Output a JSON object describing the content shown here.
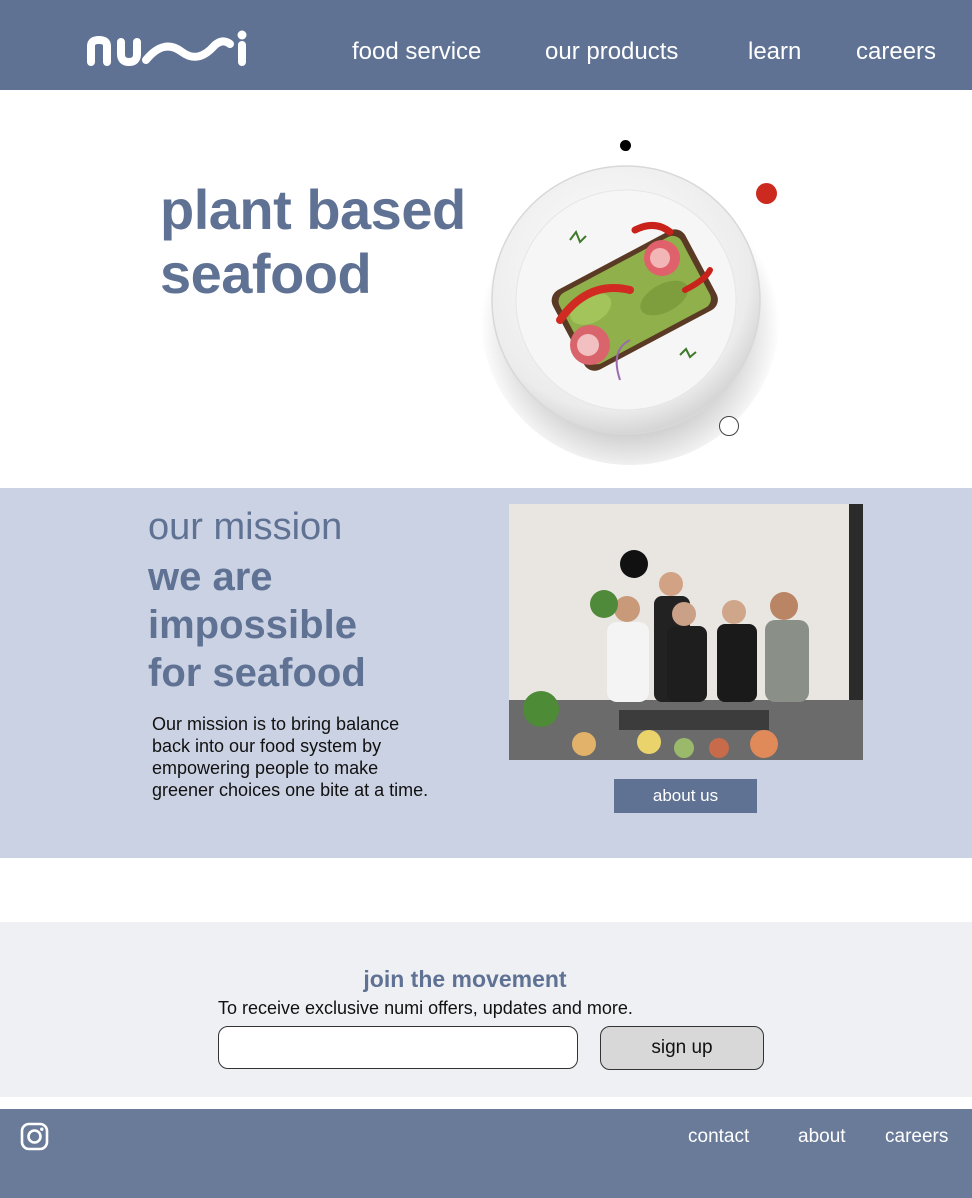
{
  "brand": {
    "logo_text": "numi"
  },
  "header": {
    "nav": [
      {
        "label": "food service"
      },
      {
        "label": "our products"
      },
      {
        "label": "learn"
      },
      {
        "label": "careers"
      }
    ]
  },
  "hero": {
    "title_line1": "plant based",
    "title_line2": "seafood"
  },
  "mission": {
    "kicker": "our mission",
    "title_line1": "we are",
    "title_line2": "impossible",
    "title_line3": "for seafood",
    "body": "Our mission is to bring balance back into our food system by empowering people to make greener choices one bite at a time.",
    "button_label": "about us"
  },
  "newsletter": {
    "title": "join the movement",
    "subtitle": "To receive exclusive numi offers, updates and more.",
    "email_value": "",
    "button_label": "sign up"
  },
  "footer": {
    "links": [
      {
        "label": "contact"
      },
      {
        "label": "about"
      },
      {
        "label": "careers"
      }
    ]
  },
  "colors": {
    "primary": "#5f7294",
    "mission_bg": "#cbd2e3",
    "newsletter_bg": "#eff0f4",
    "footer_bg": "#6a7b9a",
    "accent_red": "#cc2a1f"
  },
  "icons": {
    "social": "instagram-icon"
  }
}
